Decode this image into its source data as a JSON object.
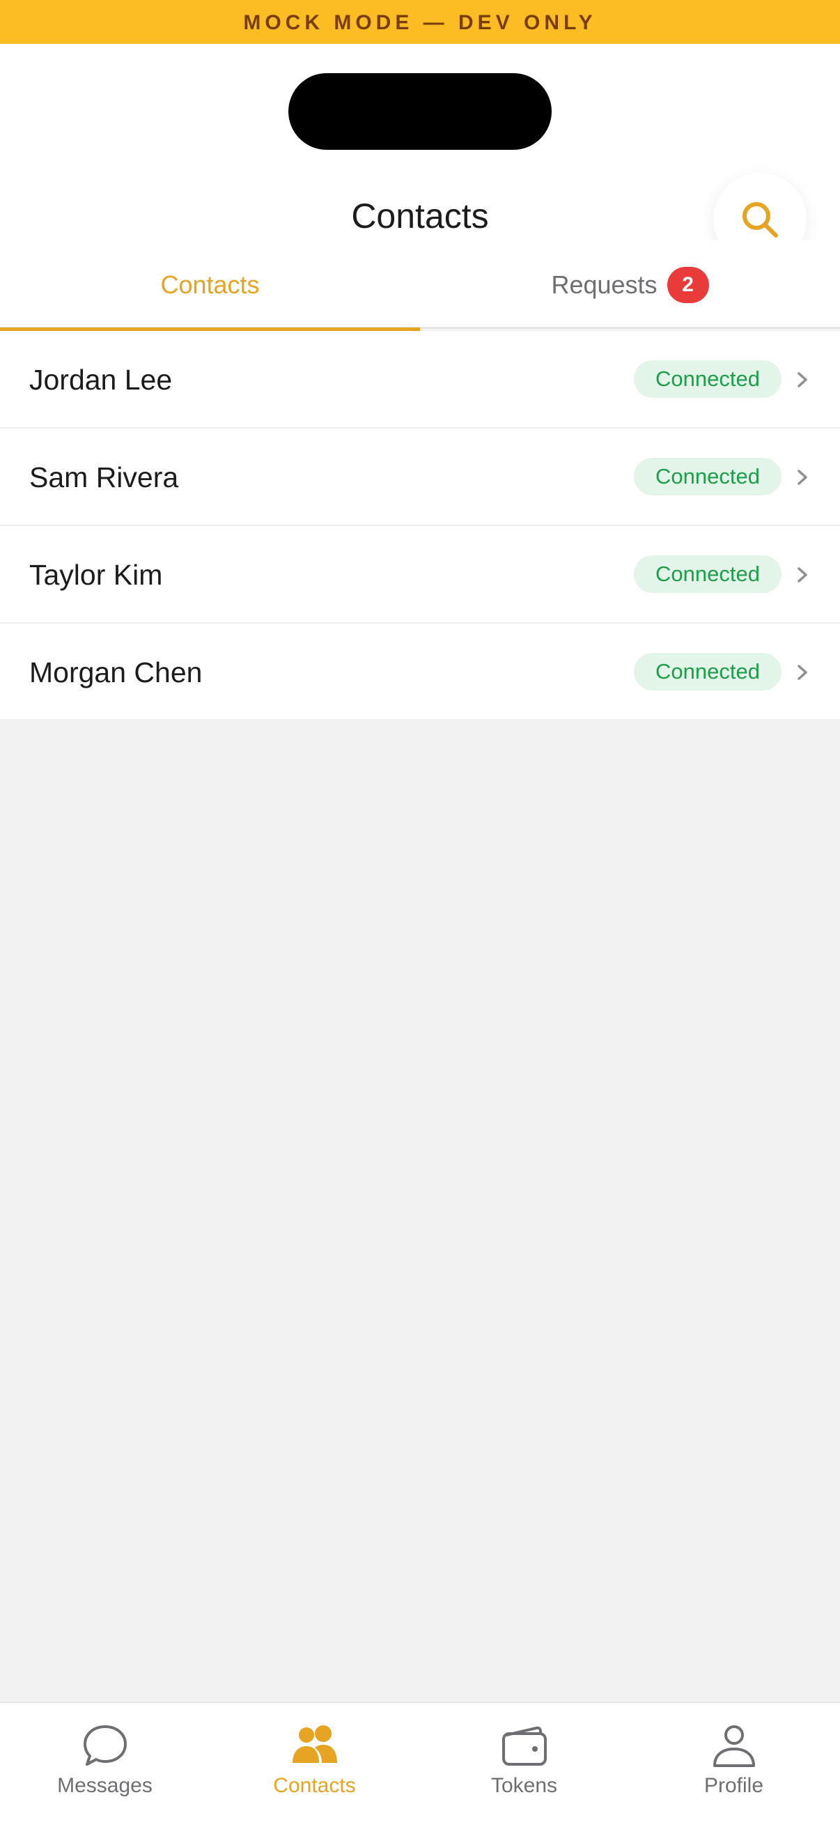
{
  "banner": {
    "text": "MOCK MODE — DEV ONLY"
  },
  "header": {
    "title": "Contacts",
    "search_icon": "search-icon"
  },
  "tabs": [
    {
      "label": "Contacts",
      "active": true
    },
    {
      "label": "Requests",
      "badge": "2",
      "active": false
    }
  ],
  "contacts": [
    {
      "name": "Jordan Lee",
      "status": "Connected"
    },
    {
      "name": "Sam Rivera",
      "status": "Connected"
    },
    {
      "name": "Taylor Kim",
      "status": "Connected"
    },
    {
      "name": "Morgan Chen",
      "status": "Connected"
    }
  ],
  "tabbar": {
    "items": [
      {
        "label": "Messages",
        "icon": "chat-icon",
        "active": false
      },
      {
        "label": "Contacts",
        "icon": "people-icon",
        "active": true
      },
      {
        "label": "Tokens",
        "icon": "wallet-icon",
        "active": false
      },
      {
        "label": "Profile",
        "icon": "person-icon",
        "active": false
      }
    ]
  },
  "colors": {
    "accent": "#e7a322",
    "banner": "#fbbd23",
    "badge_red": "#ea3b3b",
    "connected_bg": "#e3f4e8",
    "connected_text": "#1e9e4a"
  }
}
